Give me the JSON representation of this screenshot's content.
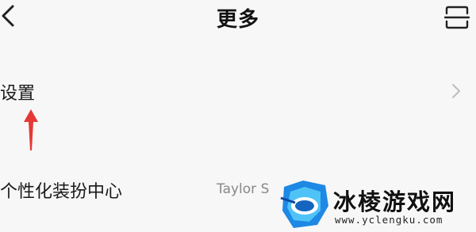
{
  "header": {
    "title": "更多",
    "back_icon": "chevron-left-icon",
    "scan_icon": "scan-icon"
  },
  "settings_row": {
    "label": "设置",
    "chevron_icon": "chevron-right-icon"
  },
  "annotation": {
    "icon": "red-arrow-up-icon",
    "color": "#e53935"
  },
  "theme_row": {
    "label": "个性化装扮中心",
    "value": "Taylor S"
  },
  "watermark": {
    "name": "冰棱游戏网",
    "url": "www.yclengku.com",
    "colors": {
      "blue": "#1e88e5",
      "cyan": "#4fc3f7"
    }
  }
}
